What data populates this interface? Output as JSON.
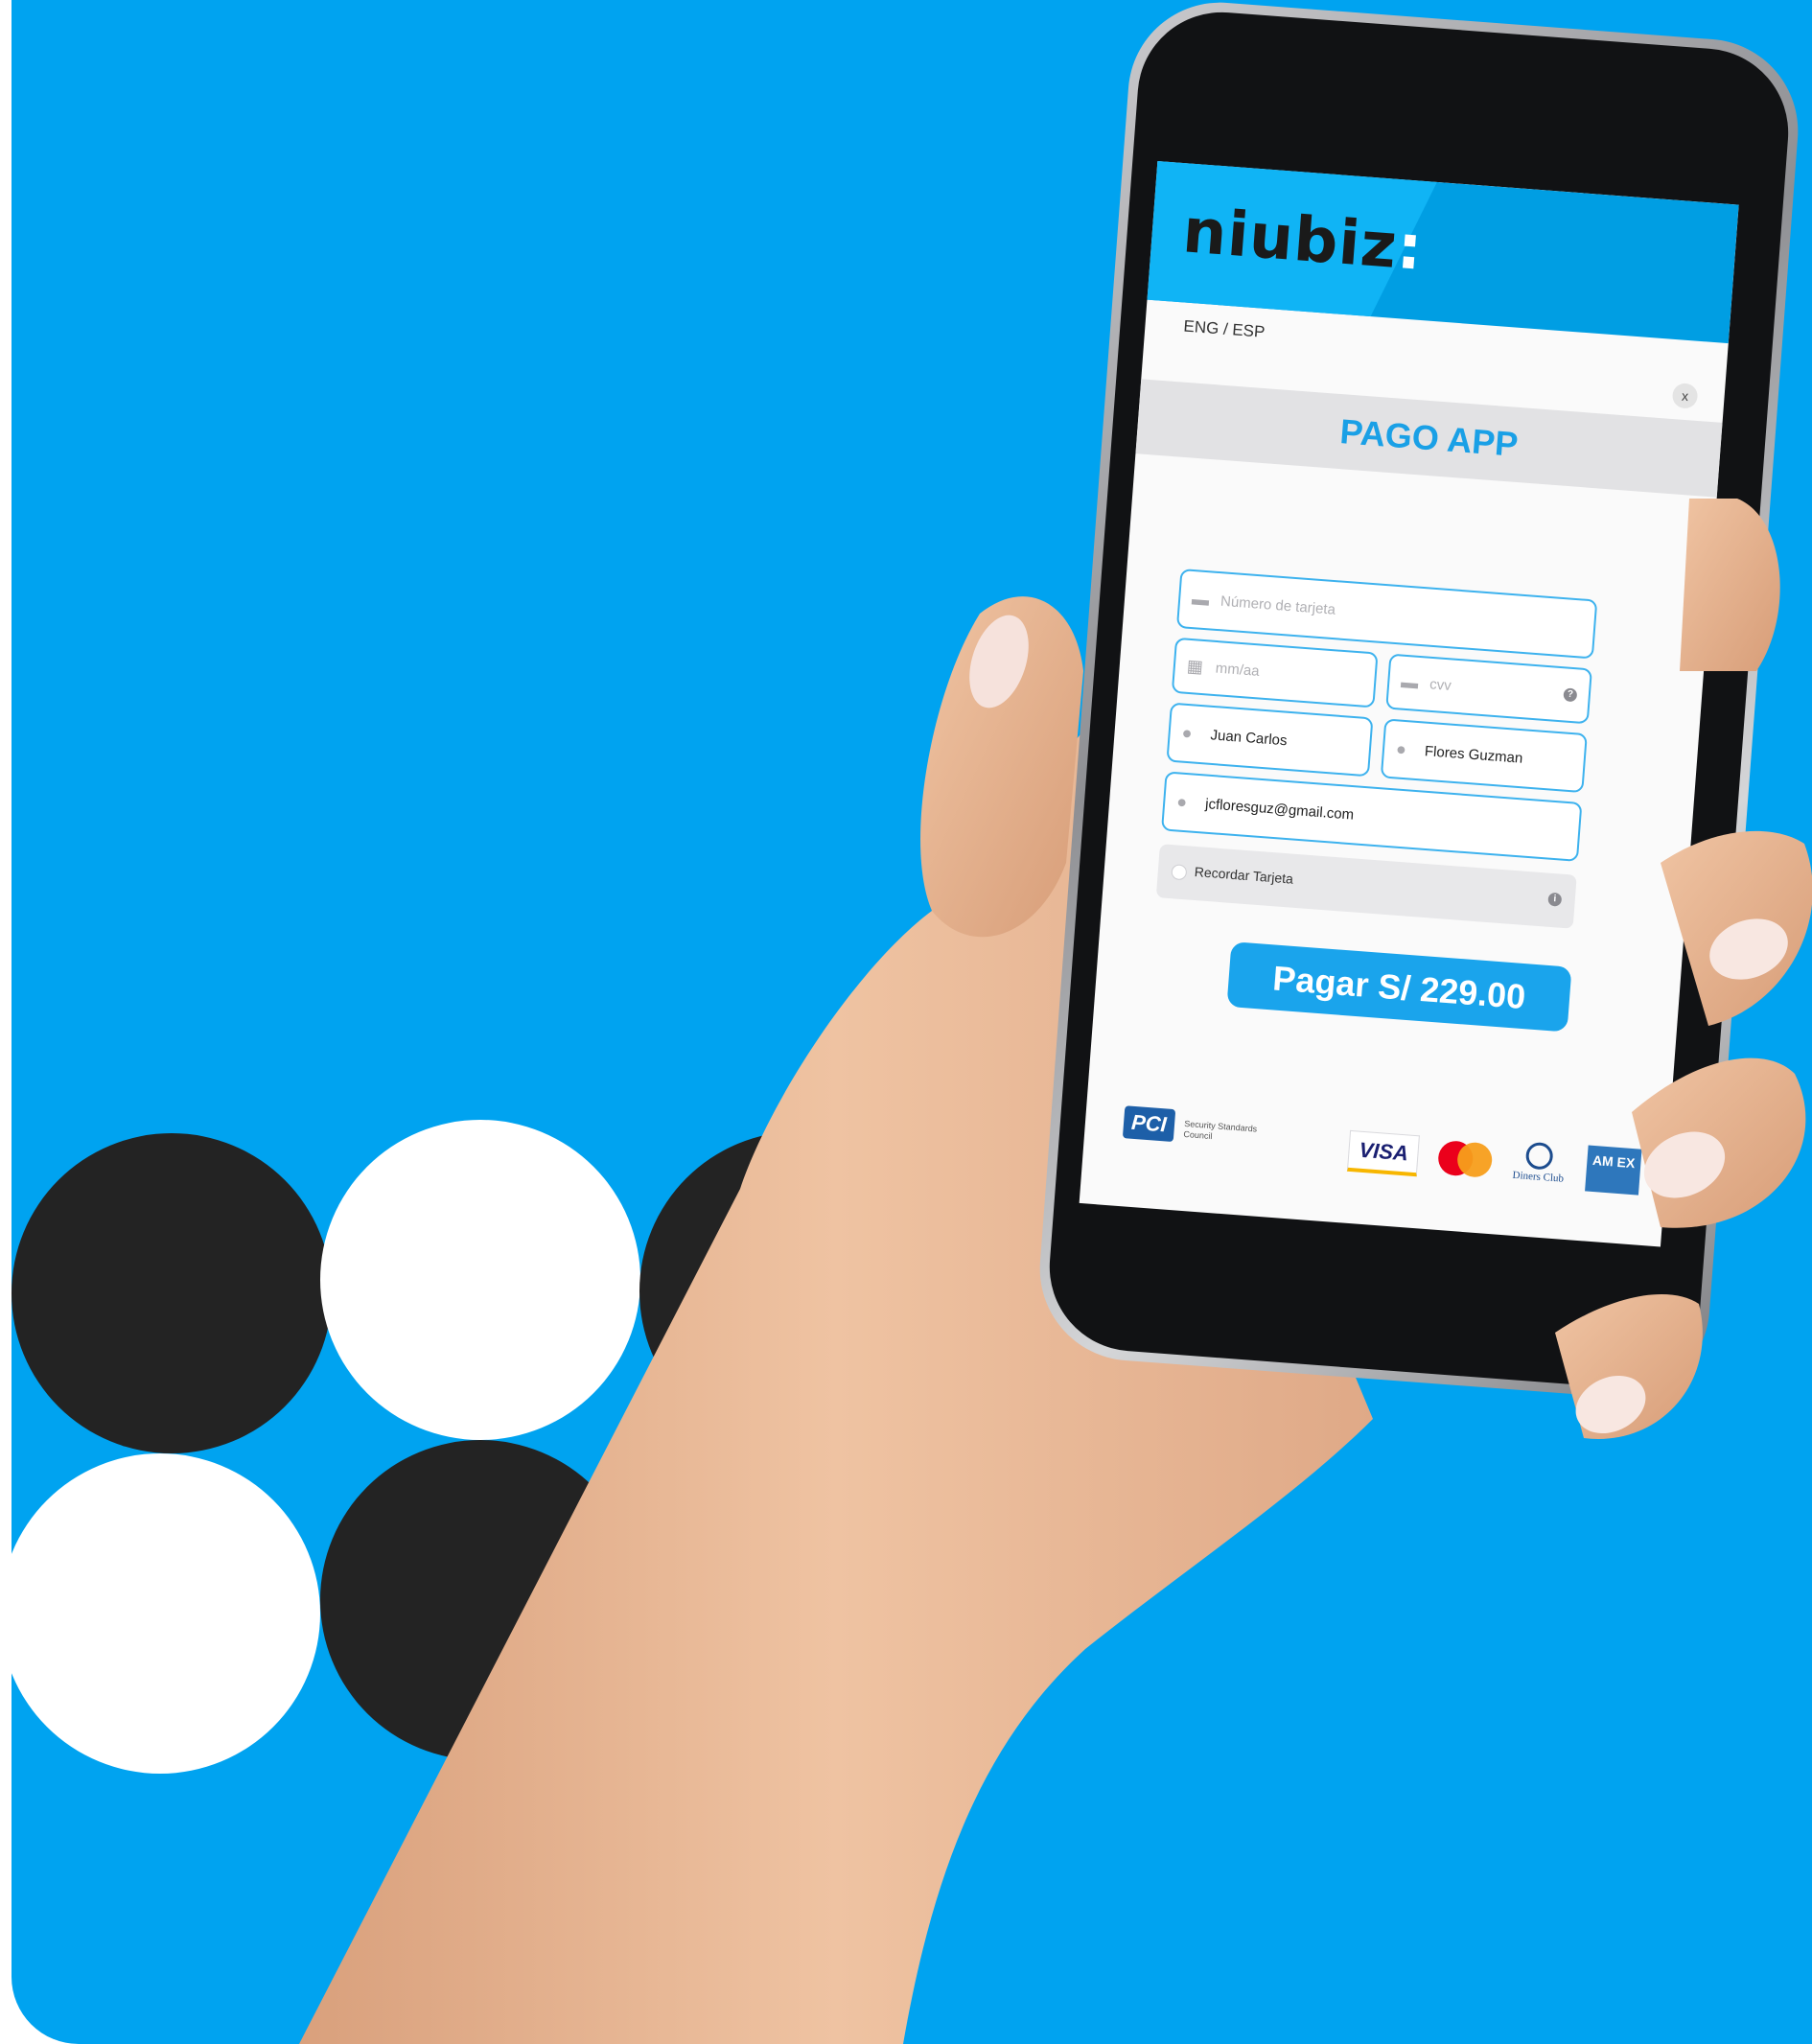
{
  "colors": {
    "background": "#00a3f0",
    "accent": "#1aa0e6",
    "dot_black": "#232323",
    "dot_white": "#ffffff"
  },
  "app": {
    "logo": "niubiz",
    "logo_suffix": ":",
    "language_toggle": "ENG / ESP",
    "close_label": "x",
    "title": "PAGO APP"
  },
  "form": {
    "card_number": {
      "placeholder": "Número de tarjeta",
      "value": "",
      "icon": "card-icon"
    },
    "expiry": {
      "placeholder": "mm/aa",
      "value": "",
      "icon": "calendar-icon"
    },
    "cvv": {
      "placeholder": "cvv",
      "value": "",
      "icon": "card-icon",
      "help": "?"
    },
    "first_name": {
      "value": "Juan Carlos",
      "icon": "user-icon"
    },
    "last_name": {
      "value": "Flores Guzman",
      "icon": "user-icon"
    },
    "email": {
      "value": "jcfloresguz@gmail.com",
      "icon": "user-icon"
    },
    "remember": {
      "label": "Recordar Tarjeta",
      "checked": false,
      "info": "i"
    },
    "pay_button": "Pagar S/ 229.00"
  },
  "footer": {
    "pci_mark": "PCI",
    "pci_text": "Security Standards Council",
    "card_brands": {
      "visa": "VISA",
      "mastercard": "mastercard",
      "diners": "Diners Club",
      "amex": "AM EX"
    }
  }
}
